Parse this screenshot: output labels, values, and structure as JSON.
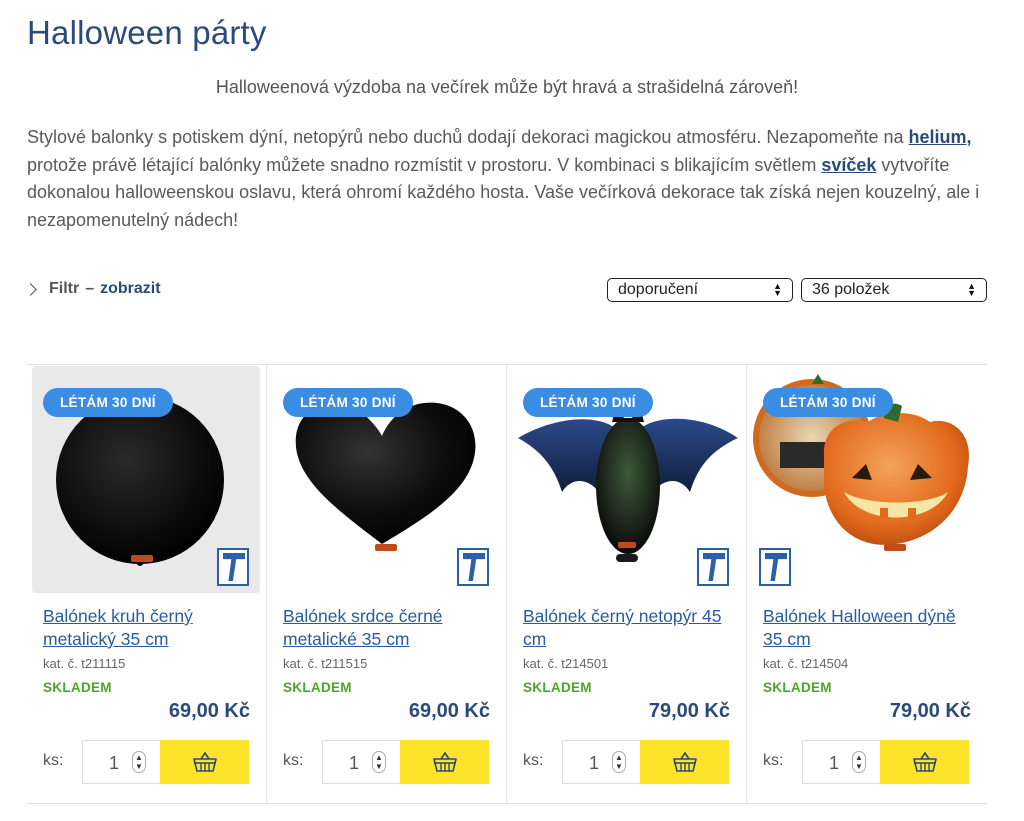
{
  "page": {
    "title": "Halloween párty",
    "lead": "Halloweenová výzdoba na večírek může být hravá a strašidelná zároveň!",
    "intro_1": "Stylové balonky s potiskem dýní, netopýrů nebo duchů dodají dekoraci magickou atmosféru. Nezapomeňte na ",
    "intro_link_1": "helium,",
    "intro_2": " protože právě létající balónky můžete snadno rozmístit v prostoru. V kombinaci s blikajícím světlem ",
    "intro_link_2": "svíček",
    "intro_3": " vytvoříte dokonalou halloweenskou oslavu, která ohromí každého hosta. Vaše večírková dekorace tak získá nejen kouzelný, ale i nezapomenutelný nádech!"
  },
  "filter": {
    "label": "Filtr",
    "dash": "–",
    "toggle": "zobrazit"
  },
  "sort": {
    "selected": "doporučení"
  },
  "per_page": {
    "selected": "36 položek"
  },
  "products": [
    {
      "badge": "LÉTÁM 30 DNÍ",
      "name": "Balónek kruh černý metalický 35 cm",
      "sku": "kat. č. t211115",
      "stock": "SKLADEM",
      "price": "69,00 Kč",
      "qty_label": "ks:",
      "qty": "1",
      "image": "black-round-balloon"
    },
    {
      "badge": "LÉTÁM 30 DNÍ",
      "name": "Balónek srdce černé metalické 35 cm",
      "sku": "kat. č. t211515",
      "stock": "SKLADEM",
      "price": "69,00 Kč",
      "qty_label": "ks:",
      "qty": "1",
      "image": "black-heart-balloon"
    },
    {
      "badge": "LÉTÁM 30 DNÍ",
      "name": "Balónek černý netopýr 45 cm",
      "sku": "kat. č. t214501",
      "stock": "SKLADEM",
      "price": "79,00 Kč",
      "qty_label": "ks:",
      "qty": "1",
      "image": "black-bat-balloon"
    },
    {
      "badge": "LÉTÁM 30 DNÍ",
      "name": "Balónek Halloween dýně 35 cm",
      "sku": "kat. č. t214504",
      "stock": "SKLADEM",
      "price": "79,00 Kč",
      "qty_label": "ks:",
      "qty": "1",
      "image": "pumpkin-balloon"
    }
  ],
  "colors": {
    "title": "#2b4a7c",
    "link": "#2b5aa0",
    "badge": "#3a8de3",
    "stock": "#4ea22f",
    "cart": "#fde42b"
  },
  "icons": {
    "cart": "basket-icon",
    "filter": "chevron-right-icon",
    "select": "updown-arrows-icon",
    "brand": "ibrex-logo-icon"
  }
}
